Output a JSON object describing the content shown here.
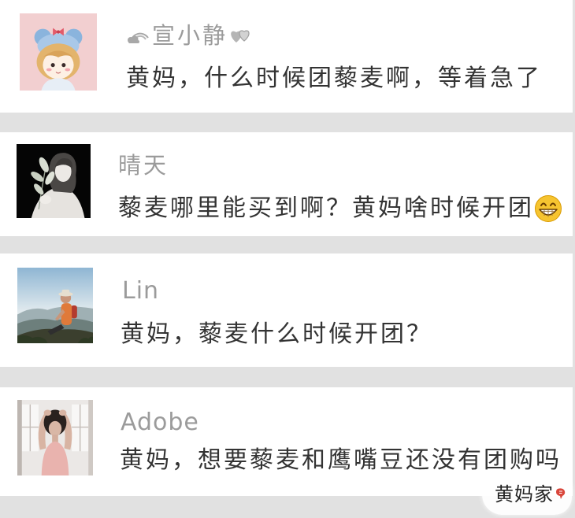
{
  "comments": [
    {
      "name": "宣小静",
      "name_icons": [
        "rainbow-cloud-icon",
        "double-heart-icon"
      ],
      "text": "黄妈，什么时候团藜麦啊，等着急了"
    },
    {
      "name": "晴天",
      "text": "藜麦哪里能买到啊？黄妈啥时候开团",
      "trailing_icon": "grinning-face-icon"
    },
    {
      "name": "Lin",
      "text": "黄妈，藜麦什么时候开团？"
    },
    {
      "name": "Adobe",
      "text": "黄妈，想要藜麦和鹰嘴豆还没有团购吗"
    }
  ],
  "watermark": {
    "text": "黄妈家",
    "icon": "red-mark-icon"
  },
  "colors": {
    "page_background": "#e1e1e1",
    "card_background": "#ffffff",
    "name_text": "#9b9b9b",
    "comment_text": "#333333",
    "watermark_icon": "#d9463b"
  }
}
